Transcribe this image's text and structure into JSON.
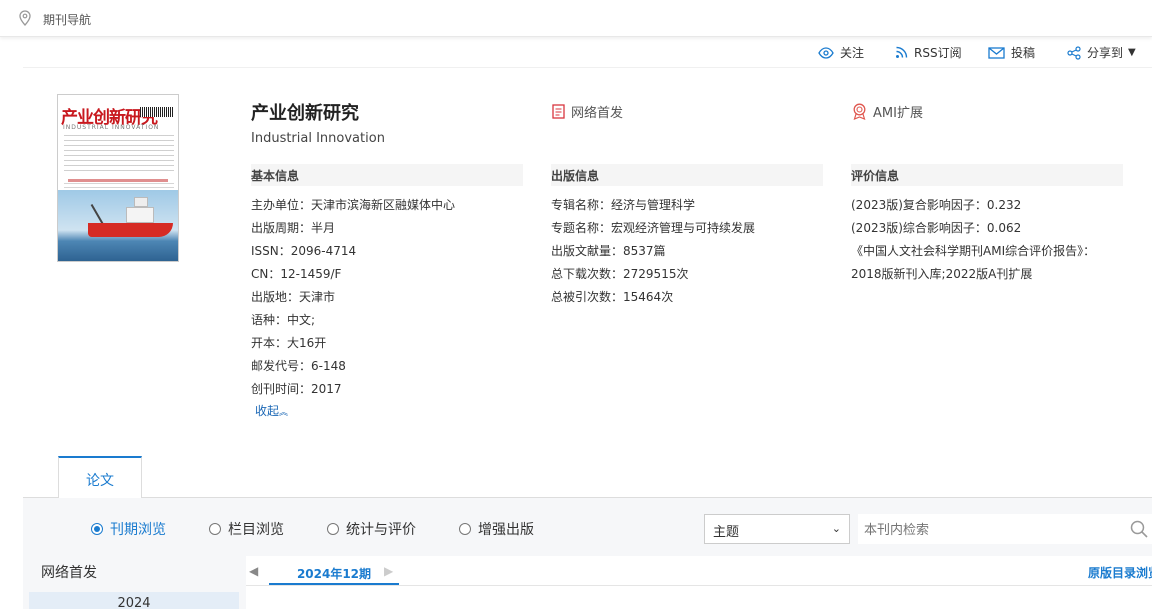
{
  "breadcrumb": {
    "label": "期刊导航"
  },
  "actions": {
    "follow": "关注",
    "rss": "RSS订阅",
    "submit": "投稿",
    "share": "分享到"
  },
  "cover": {
    "title_cn": "产业创新研究",
    "title_en": "INDUSTRIAL INNOVATION"
  },
  "journal": {
    "title": "产业创新研究",
    "subtitle": "Industrial Innovation",
    "online_first": "网络首发",
    "ami": "AMI扩展"
  },
  "basic_info": {
    "heading": "基本信息",
    "rows": [
      {
        "key": "主办单位：",
        "value": "天津市滨海新区融媒体中心"
      },
      {
        "key": "出版周期：",
        "value": "半月"
      },
      {
        "key": "ISSN：",
        "value": "2096-4714"
      },
      {
        "key": "CN：",
        "value": "12-1459/F"
      },
      {
        "key": "出版地：",
        "value": "天津市"
      },
      {
        "key": "语种：",
        "value": "中文;"
      },
      {
        "key": "开本：",
        "value": "大16开"
      },
      {
        "key": "邮发代号：",
        "value": "6-148"
      },
      {
        "key": "创刊时间：",
        "value": "2017"
      }
    ],
    "collapse": "收起"
  },
  "pub_info": {
    "heading": "出版信息",
    "rows": [
      {
        "key": "专辑名称：",
        "value": "经济与管理科学"
      },
      {
        "key": "专题名称：",
        "value": "宏观经济管理与可持续发展"
      },
      {
        "key": "出版文献量：",
        "value": "8537篇"
      },
      {
        "key": "总下载次数：",
        "value": "2729515次"
      },
      {
        "key": "总被引次数：",
        "value": "15464次"
      }
    ]
  },
  "eval_info": {
    "heading": "评价信息",
    "rows": [
      "(2023版)复合影响因子：0.232",
      "(2023版)综合影响因子：0.062",
      "《中国人文社会科学期刊AMI综合评价报告》：",
      "2018版新刊入库;2022版A刊扩展"
    ]
  },
  "tabs": {
    "papers": "论文"
  },
  "browse_modes": {
    "by_issue": "刊期浏览",
    "by_column": "栏目浏览",
    "stats": "统计与评价",
    "enhanced": "增强出版"
  },
  "search": {
    "field": "主题",
    "placeholder": "本刊内检索"
  },
  "sidebar": {
    "title": "网络首发",
    "year": "2024"
  },
  "issue_nav": {
    "prev": "◀",
    "current": "2024年12期",
    "next": "▶",
    "original_toc": "原版目录浏览"
  }
}
